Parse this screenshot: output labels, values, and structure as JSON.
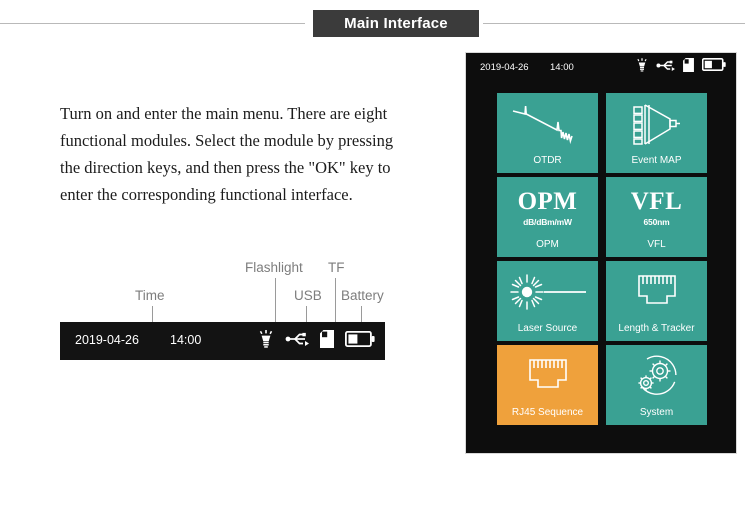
{
  "header": {
    "title": "Main Interface"
  },
  "description": {
    "text": "Turn on and enter the main menu. There are eight functional modules. Select the module by pressing the direction keys, and then press the \"OK\" key to enter the corresponding functional interface."
  },
  "annotation_diagram": {
    "labels": [
      {
        "name": "time",
        "text": "Time"
      },
      {
        "name": "flashlight",
        "text": "Flashlight"
      },
      {
        "name": "usb",
        "text": "USB"
      },
      {
        "name": "tf",
        "text": "TF"
      },
      {
        "name": "battery",
        "text": "Battery"
      }
    ],
    "statusbar": {
      "date": "2019-04-26",
      "time": "14:00",
      "icons": [
        "flashlight-icon",
        "usb-icon",
        "tf-card-icon",
        "battery-icon"
      ],
      "battery_level_percent": 40,
      "background": "#131313"
    }
  },
  "device": {
    "statusbar": {
      "date": "2019-04-26",
      "time": "14:00",
      "icons": [
        "flashlight-icon",
        "usb-icon",
        "tf-card-icon",
        "battery-icon"
      ],
      "battery_level_percent": 40
    },
    "colors": {
      "tile": "#3aa193",
      "tile_selected": "#efa13c",
      "screen_background": "#0d0d0d"
    },
    "tiles": [
      {
        "name": "otdr",
        "label": "OTDR",
        "icon": "otdr-trace-icon",
        "selected": false
      },
      {
        "name": "event-map",
        "label": "Event MAP",
        "icon": "event-map-splitter-icon",
        "selected": false
      },
      {
        "name": "opm",
        "label": "OPM",
        "icon": "opm-text-icon",
        "big": "OPM",
        "sub": "dB/dBm/mW",
        "selected": false
      },
      {
        "name": "vfl",
        "label": "VFL",
        "icon": "vfl-text-icon",
        "big": "VFL",
        "sub": "650nm",
        "selected": false
      },
      {
        "name": "laser-source",
        "label": "Laser Source",
        "icon": "laser-burst-icon",
        "selected": false
      },
      {
        "name": "length-tracker",
        "label": "Length & Tracker",
        "icon": "rj45-icon",
        "selected": false
      },
      {
        "name": "rj45-sequence",
        "label": "RJ45 Sequence",
        "icon": "rj45-icon",
        "selected": true
      },
      {
        "name": "system",
        "label": "System",
        "icon": "gears-icon",
        "selected": false
      }
    ]
  }
}
